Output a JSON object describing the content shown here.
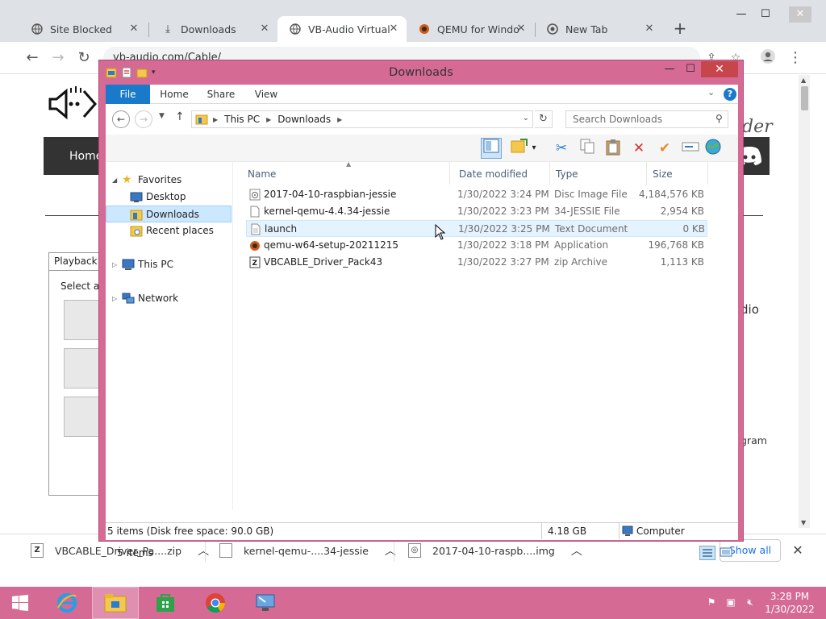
{
  "browser": {
    "tabs": [
      {
        "title": "Site Blocked",
        "icon": "globe-icon",
        "active": false
      },
      {
        "title": "Downloads",
        "icon": "download-icon",
        "active": false
      },
      {
        "title": "VB-Audio Virtual",
        "icon": "globe-icon",
        "active": true
      },
      {
        "title": "QEMU for Windo",
        "icon": "qemu-icon",
        "active": false
      },
      {
        "title": "New Tab",
        "icon": "chrome-icon",
        "active": false
      }
    ],
    "url": "vb-audio.com/Cable/"
  },
  "webpage": {
    "menu_home": "Home",
    "script_text": "der",
    "side_text_1": "dio",
    "side_text_2": "gram",
    "sound_tab": "Playback",
    "sound_text": "Select a p"
  },
  "downloads_shelf": {
    "items": [
      {
        "name": "VBCABLE_Driver_Pa....zip",
        "icon": "zip-icon"
      },
      {
        "name": "kernel-qemu-....34-jessie",
        "icon": "file-icon"
      },
      {
        "name": "2017-04-10-raspb....img",
        "icon": "disc-image-icon"
      }
    ],
    "show_all": "Show all"
  },
  "explorer": {
    "title": "Downloads",
    "ribbon_tabs": [
      "File",
      "Home",
      "Share",
      "View"
    ],
    "breadcrumb": [
      "This PC",
      "Downloads"
    ],
    "search_placeholder": "Search Downloads",
    "nav": {
      "favorites": "Favorites",
      "desktop": "Desktop",
      "downloads": "Downloads",
      "recent": "Recent places",
      "thispc": "This PC",
      "network": "Network"
    },
    "columns": [
      "Name",
      "Date modified",
      "Type",
      "Size"
    ],
    "files": [
      {
        "name": "2017-04-10-raspbian-jessie",
        "date": "1/30/2022 3:24 PM",
        "type": "Disc Image File",
        "size": "4,184,576 KB",
        "icon": "disc-image-icon"
      },
      {
        "name": "kernel-qemu-4.4.34-jessie",
        "date": "1/30/2022 3:23 PM",
        "type": "34-JESSIE File",
        "size": "2,954 KB",
        "icon": "file-icon"
      },
      {
        "name": "launch",
        "date": "1/30/2022 3:25 PM",
        "type": "Text Document",
        "size": "0 KB",
        "icon": "text-file-icon"
      },
      {
        "name": "qemu-w64-setup-20211215",
        "date": "1/30/2022 3:18 PM",
        "type": "Application",
        "size": "196,768 KB",
        "icon": "qemu-icon"
      },
      {
        "name": "VBCABLE_Driver_Pack43",
        "date": "1/30/2022 3:27 PM",
        "type": "zip Archive",
        "size": "1,113 KB",
        "icon": "zip-icon"
      }
    ],
    "item_count": "5 items",
    "status_left": "5 items (Disk free space: 90.0 GB)",
    "status_size": "4.18 GB",
    "status_location": "Computer"
  },
  "taskbar": {
    "time": "3:28 PM",
    "date": "1/30/2022"
  },
  "colors": {
    "window_frame": "#d56a95",
    "close_red": "#c7464c",
    "ribbon_blue": "#1979ca",
    "selection": "#cce8ff"
  }
}
